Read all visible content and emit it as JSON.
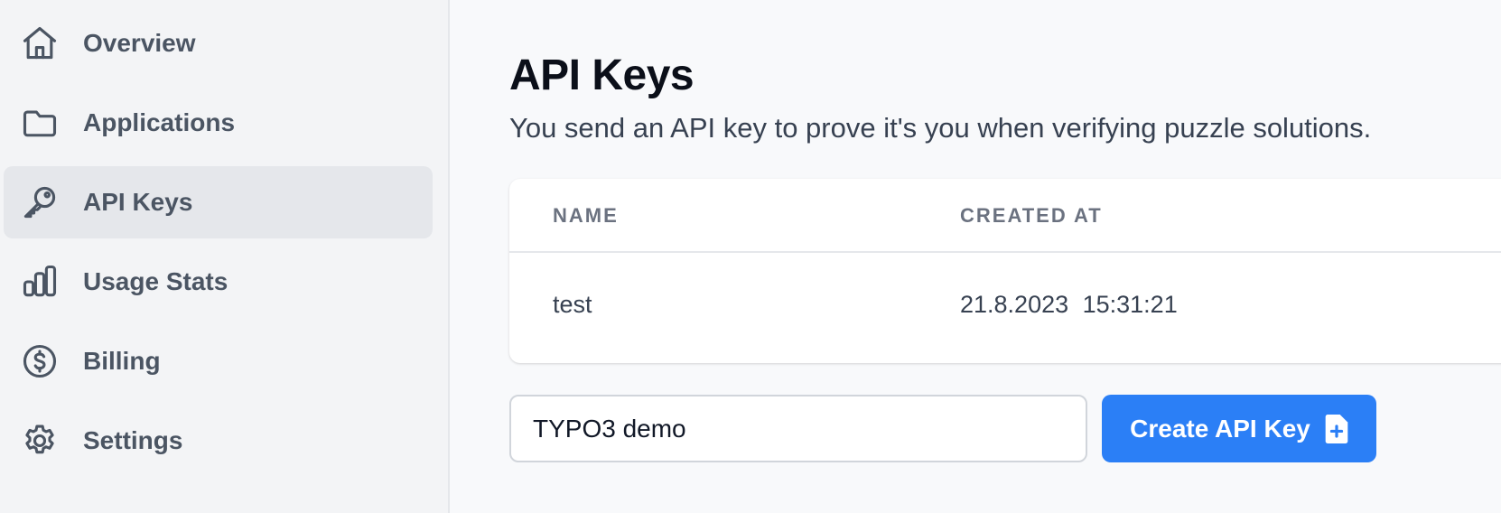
{
  "sidebar": {
    "items": [
      {
        "label": "Overview",
        "icon": "home-icon",
        "active": false
      },
      {
        "label": "Applications",
        "icon": "folder-icon",
        "active": false
      },
      {
        "label": "API Keys",
        "icon": "key-icon",
        "active": true
      },
      {
        "label": "Usage Stats",
        "icon": "bar-chart-icon",
        "active": false
      },
      {
        "label": "Billing",
        "icon": "dollar-circle-icon",
        "active": false
      },
      {
        "label": "Settings",
        "icon": "gear-icon",
        "active": false
      }
    ]
  },
  "page": {
    "title": "API Keys",
    "description": "You send an API key to prove it's you when verifying puzzle solutions."
  },
  "table": {
    "columns": [
      "Name",
      "Created at"
    ],
    "rows": [
      {
        "name": "test",
        "created_at": "21.8.2023 15:31:21"
      }
    ]
  },
  "create_form": {
    "input_value": "TYPO3 demo",
    "button_label": "Create API Key",
    "button_icon": "file-plus-icon"
  },
  "colors": {
    "accent": "#2b7ff6",
    "sidebar_bg": "#f3f4f6",
    "active_item_bg": "#e5e7eb",
    "page_bg": "#f8f9fb"
  }
}
